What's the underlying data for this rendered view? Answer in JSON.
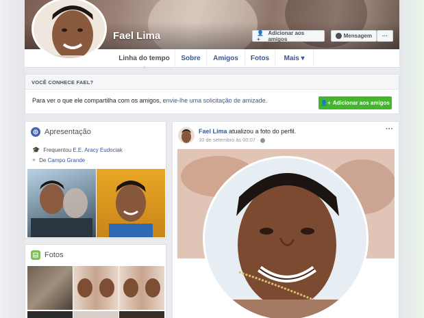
{
  "profile": {
    "name": "Fael Lima"
  },
  "cover_actions": {
    "add_friend": "Adicionar aos amigos",
    "message": "Mensagem",
    "more": "···"
  },
  "nav": {
    "tabs": [
      {
        "label": "Linha do tempo"
      },
      {
        "label": "Sobre"
      },
      {
        "label": "Amigos"
      },
      {
        "label": "Fotos"
      },
      {
        "label": "Mais ▾"
      }
    ]
  },
  "know_box": {
    "heading": "VOCÊ CONHECE FAEL?",
    "text_before": "Para ver o que ele compartilha com os amigos, ",
    "link": "envie-lhe uma solicitação de amizade",
    "text_after": ".",
    "button": "Adicionar aos amigos"
  },
  "intro": {
    "title": "Apresentação",
    "studied_prefix": "Frequentou ",
    "school": "E.E. Aracy Eudociak",
    "from_prefix": "De ",
    "city": "Campo Grande"
  },
  "photos_card": {
    "title": "Fotos"
  },
  "post": {
    "author": "Fael Lima",
    "action": " atualizou a foto do perfil.",
    "time": "10 de setembro às 00:07 · ",
    "privacy_icon": "globe-icon",
    "menu": "···"
  },
  "colors": {
    "link": "#365899",
    "green_button": "#42b72a",
    "background": "#e9ebee"
  }
}
